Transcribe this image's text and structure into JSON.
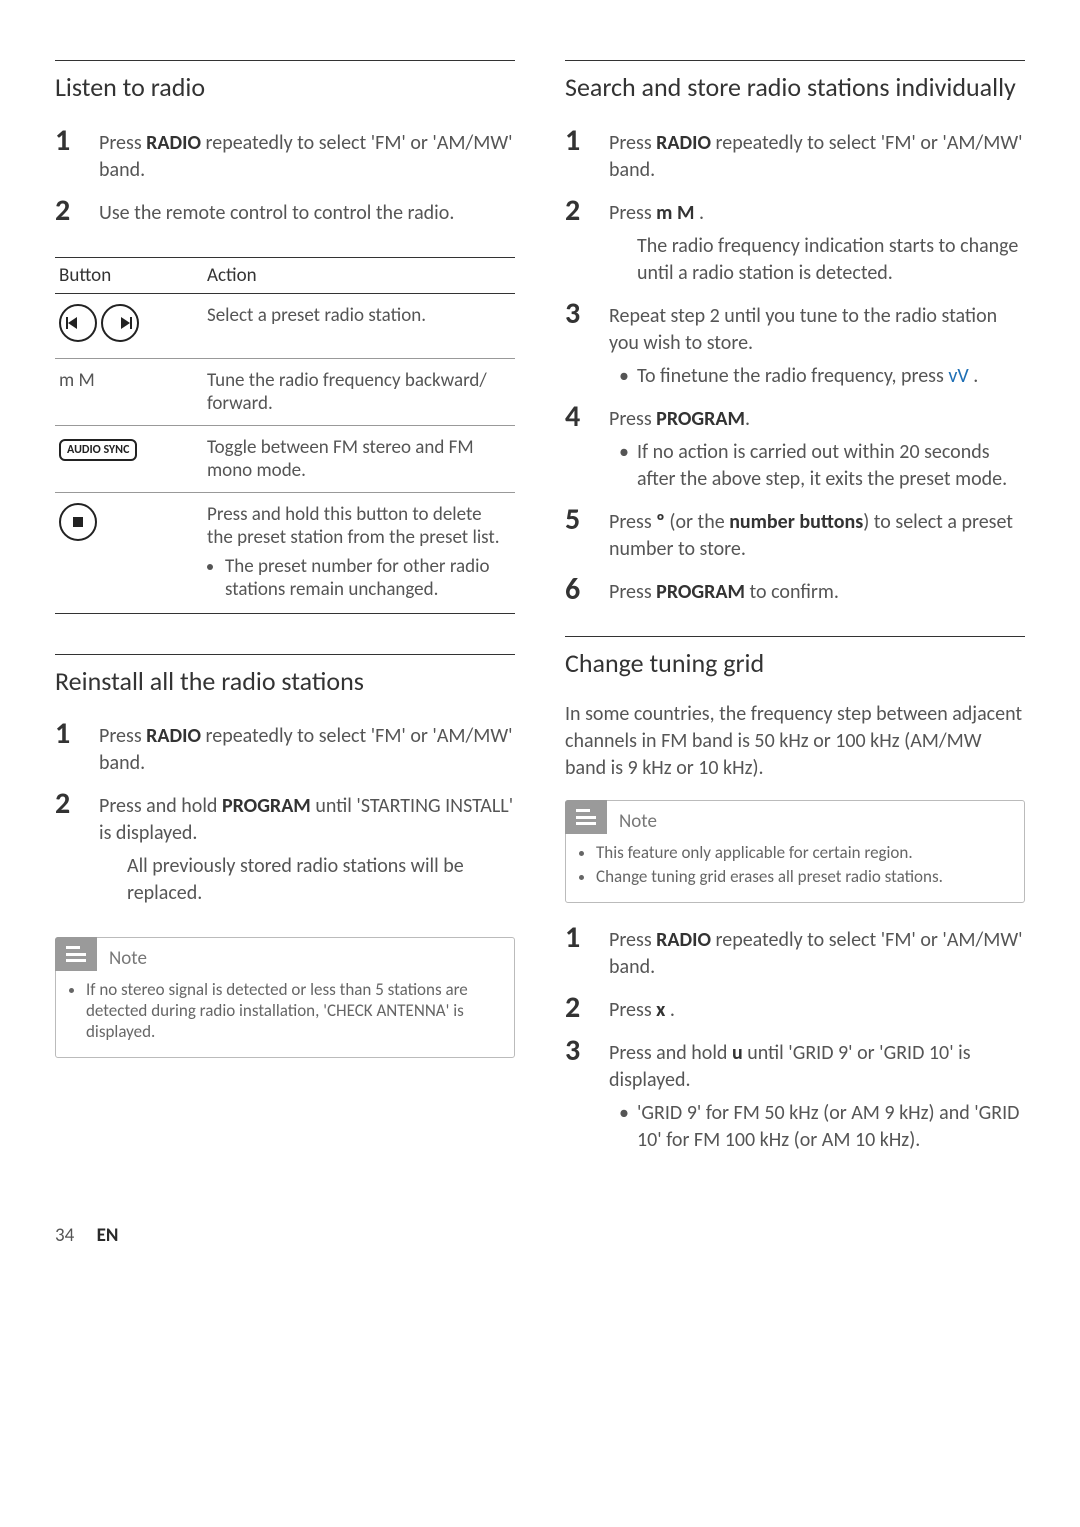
{
  "left": {
    "s1": {
      "title": "Listen to radio",
      "step1_a": "Press ",
      "step1_b": "RADIO",
      "step1_c": " repeatedly to select 'FM' or 'AM/MW' band.",
      "step2": "Use the remote control to control the radio.",
      "table": {
        "h1": "Button",
        "h2": "Action",
        "r1_btn": "prev-next-icons",
        "r1_act": "Select a preset radio station.",
        "r2_btn": "m M",
        "r2_act": "Tune the radio frequency backward/ forward.",
        "r3_btn": "AUDIO SYNC",
        "r3_act": "Toggle between FM stereo and FM mono mode.",
        "r4_act_a": "Press and hold this button to delete the preset station from the preset list.",
        "r4_act_b": "The preset number for other radio stations remain unchanged."
      }
    },
    "s2": {
      "title": "Reinstall all the radio stations",
      "step1_a": "Press ",
      "step1_b": "RADIO",
      "step1_c": " repeatedly to select 'FM' or 'AM/MW' band.",
      "step2_a": "Press and hold ",
      "step2_b": "PROGRAM",
      "step2_c": " until 'STARTING INSTALL' is displayed.",
      "step2_sub": "All previously stored radio stations will be replaced.",
      "note_title": "Note",
      "note_body": "If no stereo signal is detected or less than 5 stations are detected during radio installation, 'CHECK ANTENNA' is displayed."
    }
  },
  "right": {
    "s1": {
      "title": "Search and store radio stations individually",
      "step1_a": "Press ",
      "step1_b": "RADIO",
      "step1_c": " repeatedly to select 'FM' or 'AM/MW' band.",
      "step2_a": "Press ",
      "step2_b": "m   M",
      "step2_c": " .",
      "step2_sub": "The radio frequency indication starts to change until a radio station is detected.",
      "step3": "Repeat step 2 until you tune to the radio station you wish to store.",
      "step3_bullet_a": "To finetune the radio frequency, press ",
      "step3_bullet_b": "vV",
      "step3_bullet_c": " .",
      "step4_a": "Press ",
      "step4_b": "PROGRAM",
      "step4_c": ".",
      "step4_bullet": "If no action is carried out within 20 seconds after the above step, it exits the preset mode.",
      "step5_a": "Press     ",
      "step5_b": "º",
      "step5_c": "    (or the ",
      "step5_d": "number buttons",
      "step5_e": ") to select a preset number to store.",
      "step6_a": "Press ",
      "step6_b": "PROGRAM",
      "step6_c": " to confirm."
    },
    "s2": {
      "title": "Change tuning grid",
      "intro": "In some countries, the frequency step between adjacent channels in FM band is 50 kHz or 100 kHz (AM/MW band is 9 kHz or 10 kHz).",
      "note_title": "Note",
      "note_b1": "This feature only applicable for certain region.",
      "note_b2": "Change tuning grid erases all preset radio stations.",
      "step1_a": "Press ",
      "step1_b": "RADIO",
      "step1_c": " repeatedly to select 'FM' or 'AM/MW' band.",
      "step2_a": "Press ",
      "step2_b": "x",
      "step2_c": " .",
      "step3_a": "Press and hold ",
      "step3_b": "u",
      "step3_c": "    until 'GRID 9' or 'GRID 10' is displayed.",
      "step3_bullet": "'GRID 9' for FM 50 kHz (or AM 9 kHz) and 'GRID 10' for FM 100 kHz (or AM 10 kHz)."
    }
  },
  "footer": {
    "page": "34",
    "lang": "EN"
  }
}
